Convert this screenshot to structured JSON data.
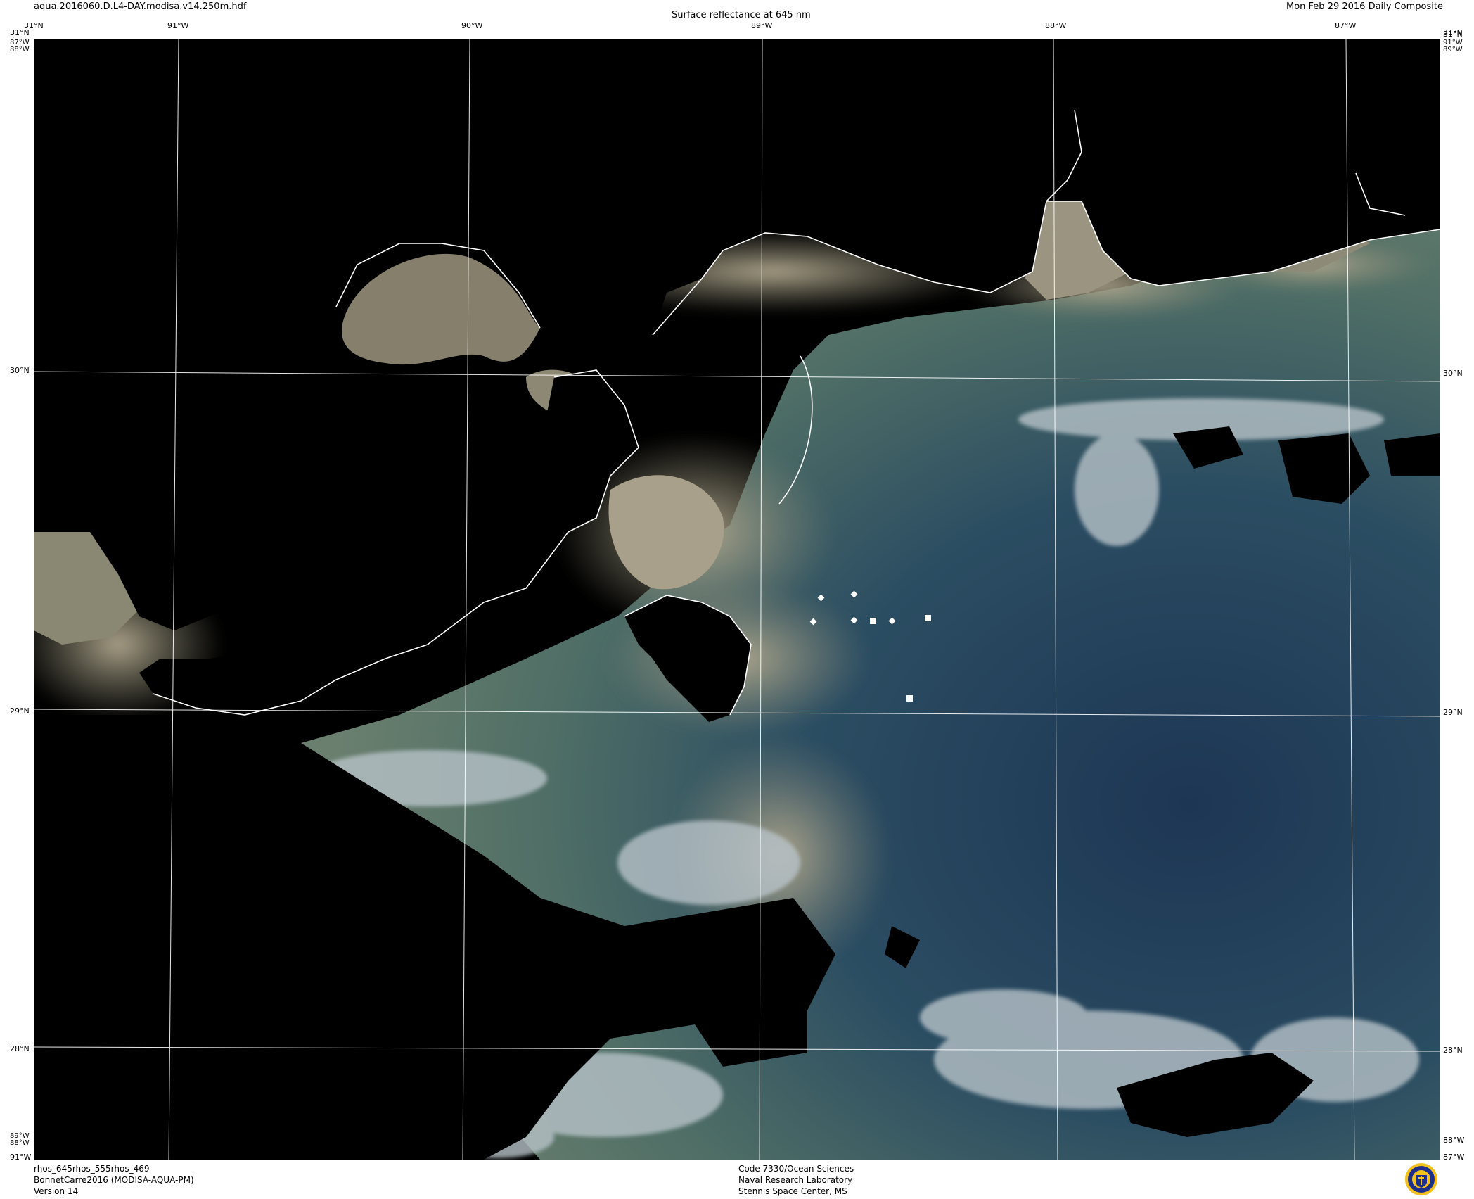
{
  "header": {
    "filename": "aqua.2016060.D.L4-DAY.modisa.v14.250m.hdf",
    "title": "Surface reflectance at 645 nm",
    "date": "Mon Feb 29 2016 Daily Composite"
  },
  "map": {
    "colors": {
      "background": "#000000",
      "sediment": "#a89e86",
      "shelf_green": "#5c7a68",
      "deep_blue": "#1f3a55",
      "cloud": "#b8c4cc",
      "coastline": "#ffffff",
      "graticule": "#ffffff"
    },
    "graticule_lines": {
      "longitudes": [
        "91°W",
        "90°W",
        "89°W",
        "88°W",
        "87°W"
      ],
      "latitudes": [
        "31°N",
        "30°N",
        "29°N",
        "28°N"
      ]
    },
    "top_ticks": [
      "31°N",
      "91°W",
      "90°W",
      "89°W",
      "88°W",
      "87°W",
      "31°N"
    ],
    "top_corner_left": "87°W 88°W",
    "top_corner_right": "91°W 89°W",
    "left_ticks": [
      "31°N",
      "30°N",
      "29°N",
      "28°N",
      "91°W"
    ],
    "right_ticks": [
      "31°N",
      "30°N",
      "29°N",
      "28°N",
      "87°W"
    ],
    "bottom_left_corner": "89°W 88°W",
    "bottom_right_corner": "88°W",
    "stations": [
      "diamond",
      "diamond",
      "diamond",
      "square",
      "diamond",
      "square",
      "diamond",
      "square"
    ]
  },
  "footer": {
    "left_line1": "rhos_645rhos_555rhos_469",
    "left_line2": "BonnetCarre2016 (MODISA-AQUA-PM)",
    "left_line3": "Version 14",
    "center_line1": "Code 7330/Ocean Sciences",
    "center_line2": "Naval Research Laboratory",
    "center_line3": "Stennis Space Center, MS"
  },
  "logo": {
    "name": "nrl-seal-icon"
  }
}
